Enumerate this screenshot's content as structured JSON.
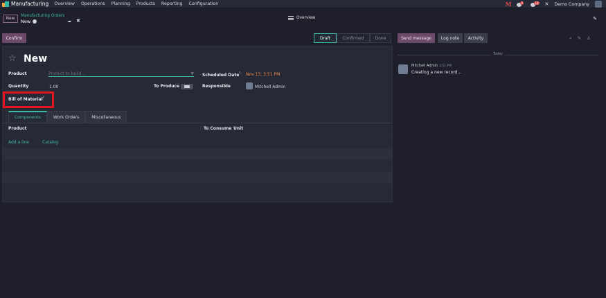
{
  "navbar": {
    "app_name": "Manufacturing",
    "menu": [
      "Overview",
      "Operations",
      "Planning",
      "Products",
      "Reporting",
      "Configuration"
    ],
    "discuss_badge": "5",
    "activity_badge": "10",
    "company": "Demo Company"
  },
  "control_panel": {
    "new_label": "New",
    "breadcrumb_parent": "Manufacturing Orders",
    "breadcrumb_current": "New",
    "overview_label": "Overview"
  },
  "form": {
    "confirm_label": "Confirm",
    "statuses": [
      "Draft",
      "Confirmed",
      "Done"
    ],
    "active_status": "Draft",
    "title": "New",
    "product_label": "Product",
    "product_placeholder": "Product to build...",
    "quantity_label": "Quantity",
    "quantity_value": "1.00",
    "to_produce_label": "To Produce",
    "bom_label": "Bill of Material",
    "help_mark": "?",
    "scheduled_label": "Scheduled Date",
    "scheduled_value": "Nov 13, 3:51 PM",
    "responsible_label": "Responsible",
    "responsible_value": "Mitchell Admin",
    "tabs": [
      "Components",
      "Work Orders",
      "Miscellaneous"
    ],
    "table_headers": [
      "Product",
      "To Consume",
      "Unit"
    ],
    "add_line": "Add a line",
    "catalog": "Catalog"
  },
  "chatter": {
    "send_message": "Send message",
    "log_note": "Log note",
    "activity": "Activity",
    "today": "Today",
    "author": "Mitchell Admin",
    "time": "3:51 PM",
    "message": "Creating a new record..."
  },
  "colors": {
    "accent": "#3fb8a8",
    "primary": "#6c4a6a",
    "date": "#f08a4b",
    "highlight_box": "#e3141b"
  }
}
